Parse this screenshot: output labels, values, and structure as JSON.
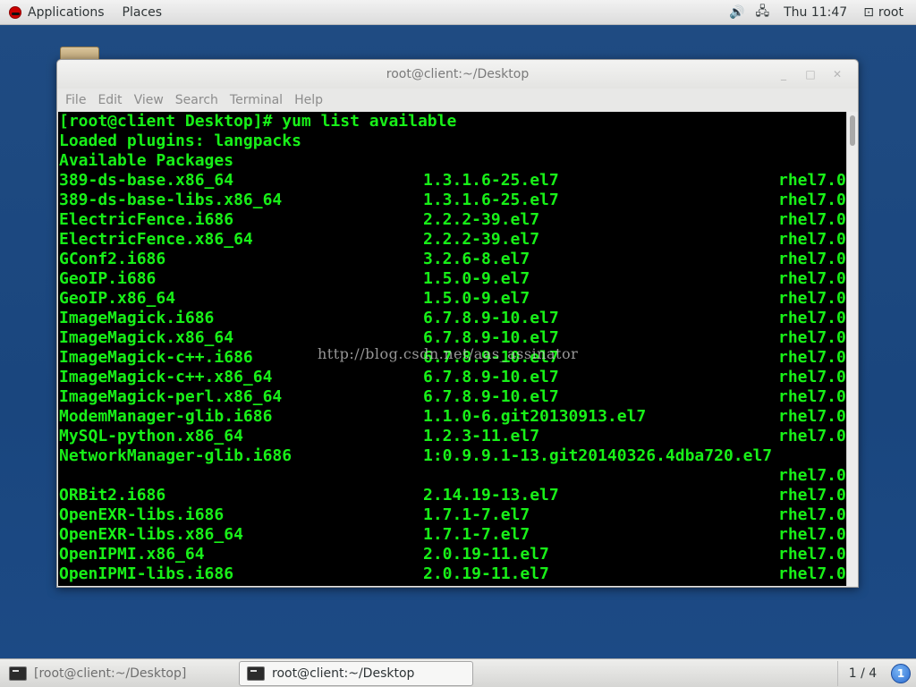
{
  "topbar": {
    "applications_label": "Applications",
    "places_label": "Places",
    "clock": "Thu 11:47",
    "user": "root",
    "icons": [
      "redhat-icon",
      "volume-icon",
      "network-icon",
      "user-icon"
    ]
  },
  "window": {
    "title": "root@client:~/Desktop",
    "menu": [
      "File",
      "Edit",
      "View",
      "Search",
      "Terminal",
      "Help"
    ],
    "controls": [
      "minimize-icon",
      "maximize-icon",
      "close-icon"
    ]
  },
  "terminal": {
    "header_lines": [
      "[root@client Desktop]# yum list available",
      "Loaded plugins: langpacks",
      "Available Packages"
    ],
    "rows": [
      [
        "389-ds-base.x86_64",
        "1.3.1.6-25.el7",
        "rhel7.0"
      ],
      [
        "389-ds-base-libs.x86_64",
        "1.3.1.6-25.el7",
        "rhel7.0"
      ],
      [
        "ElectricFence.i686",
        "2.2.2-39.el7",
        "rhel7.0"
      ],
      [
        "ElectricFence.x86_64",
        "2.2.2-39.el7",
        "rhel7.0"
      ],
      [
        "GConf2.i686",
        "3.2.6-8.el7",
        "rhel7.0"
      ],
      [
        "GeoIP.i686",
        "1.5.0-9.el7",
        "rhel7.0"
      ],
      [
        "GeoIP.x86_64",
        "1.5.0-9.el7",
        "rhel7.0"
      ],
      [
        "ImageMagick.i686",
        "6.7.8.9-10.el7",
        "rhel7.0"
      ],
      [
        "ImageMagick.x86_64",
        "6.7.8.9-10.el7",
        "rhel7.0"
      ],
      [
        "ImageMagick-c++.i686",
        "6.7.8.9-10.el7",
        "rhel7.0"
      ],
      [
        "ImageMagick-c++.x86_64",
        "6.7.8.9-10.el7",
        "rhel7.0"
      ],
      [
        "ImageMagick-perl.x86_64",
        "6.7.8.9-10.el7",
        "rhel7.0"
      ],
      [
        "ModemManager-glib.i686",
        "1.1.0-6.git20130913.el7",
        "rhel7.0"
      ],
      [
        "MySQL-python.x86_64",
        "1.2.3-11.el7",
        "rhel7.0"
      ],
      [
        "NetworkManager-glib.i686",
        "1:0.9.9.1-13.git20140326.4dba720.el7",
        ""
      ],
      [
        "",
        "",
        "rhel7.0"
      ],
      [
        "ORBit2.i686",
        "2.14.19-13.el7",
        "rhel7.0"
      ],
      [
        "OpenEXR-libs.i686",
        "1.7.1-7.el7",
        "rhel7.0"
      ],
      [
        "OpenEXR-libs.x86_64",
        "1.7.1-7.el7",
        "rhel7.0"
      ],
      [
        "OpenIPMI.x86_64",
        "2.0.19-11.el7",
        "rhel7.0"
      ],
      [
        "OpenIPMI-libs.i686",
        "2.0.19-11.el7",
        "rhel7.0"
      ]
    ],
    "watermark": "http://blog.csdn.net/aas_assinator"
  },
  "taskbar": {
    "tasks": [
      "[root@client:~/Desktop]",
      "root@client:~/Desktop"
    ],
    "workspace": "1 / 4",
    "notification_badge": "1"
  }
}
